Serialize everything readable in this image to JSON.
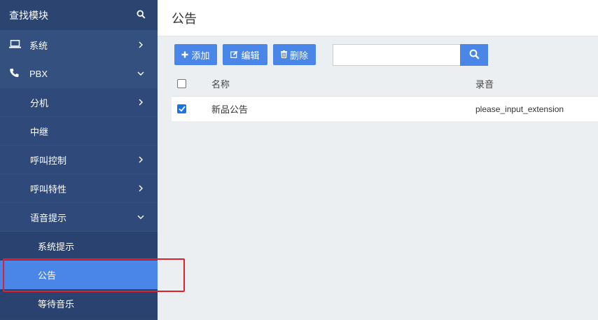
{
  "sidebar": {
    "search_label": "查找模块",
    "items": [
      {
        "label": "系统",
        "icon": "laptop-icon",
        "chevron": "right"
      },
      {
        "label": "PBX",
        "icon": "phone-icon",
        "chevron": "down"
      },
      {
        "label": "分机",
        "chevron": "right"
      },
      {
        "label": "中继",
        "chevron": ""
      },
      {
        "label": "呼叫控制",
        "chevron": "right"
      },
      {
        "label": "呼叫特性",
        "chevron": "right"
      },
      {
        "label": "语音提示",
        "chevron": "down"
      },
      {
        "label": "系统提示"
      },
      {
        "label": "公告",
        "active": true
      },
      {
        "label": "等待音乐"
      }
    ]
  },
  "main": {
    "title": "公告",
    "toolbar": {
      "add_label": "添加",
      "edit_label": "编辑",
      "delete_label": "删除"
    },
    "search": {
      "value": "",
      "placeholder": ""
    },
    "table": {
      "columns": [
        "名称",
        "录音"
      ],
      "rows": [
        {
          "checked": true,
          "name": "新品公告",
          "voice": "please_input_extension"
        }
      ]
    }
  },
  "colors": {
    "sidebar_bg": "#2c4470",
    "accent": "#4a86e8",
    "highlight": "#e0212b"
  }
}
